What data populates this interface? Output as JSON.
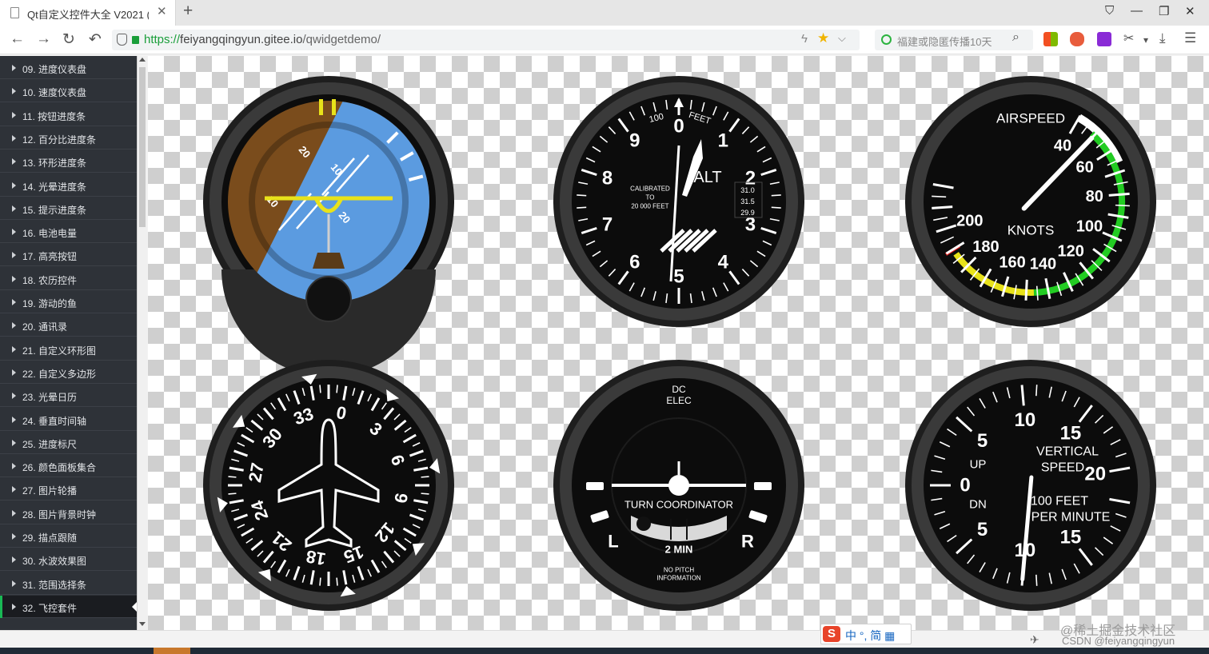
{
  "browser": {
    "tab_title": "Qt自定义控件大全 V2021 (Q",
    "tab_close": "✕",
    "new_tab": "+",
    "url_scheme": "https://",
    "url_host": "feiyangqingyun.gitee.io",
    "url_path": "/qwidgetdemo/",
    "search_placeholder": "福建或隐匿传播10天",
    "icons": {
      "back": "←",
      "forward": "→",
      "reload": "↻",
      "undo": "↶",
      "bolt": "ϟ",
      "star": "★",
      "chevron": "⌵",
      "search": "⌕",
      "shirt": "⛉",
      "minimize": "—",
      "restore": "❐",
      "close": "✕",
      "cut": "✂",
      "download": "⤓",
      "menu": "☰",
      "drop": "▾"
    }
  },
  "sidebar": {
    "items": [
      {
        "label": "09. 进度仪表盘"
      },
      {
        "label": "10. 速度仪表盘"
      },
      {
        "label": "11. 按钮进度条"
      },
      {
        "label": "12. 百分比进度条"
      },
      {
        "label": "13. 环形进度条"
      },
      {
        "label": "14. 光晕进度条"
      },
      {
        "label": "15. 提示进度条"
      },
      {
        "label": "16. 电池电量"
      },
      {
        "label": "17. 高亮按钮"
      },
      {
        "label": "18. 农历控件"
      },
      {
        "label": "19. 游动的鱼"
      },
      {
        "label": "20. 通讯录"
      },
      {
        "label": "21. 自定义环形图"
      },
      {
        "label": "22. 自定义多边形"
      },
      {
        "label": "23. 光晕日历"
      },
      {
        "label": "24. 垂直时间轴"
      },
      {
        "label": "25. 进度标尺"
      },
      {
        "label": "26. 颜色面板集合"
      },
      {
        "label": "27. 图片轮播"
      },
      {
        "label": "28. 图片背景时钟"
      },
      {
        "label": "29. 描点跟随"
      },
      {
        "label": "30. 水波效果图"
      },
      {
        "label": "31. 范围选择条"
      },
      {
        "label": "32. 飞控套件"
      }
    ],
    "active_index": 23
  },
  "gauges": {
    "attitude": {
      "pitch_labels": [
        "20",
        "10",
        "10",
        "20"
      ],
      "roll_labels": [
        "10",
        "10"
      ],
      "colors": {
        "sky": "#5b9be0",
        "ground": "#7a4c1c",
        "indicator": "#e8e21a"
      }
    },
    "altimeter": {
      "digits": [
        "0",
        "1",
        "2",
        "3",
        "4",
        "5",
        "6",
        "7",
        "8",
        "9"
      ],
      "label_feet": "FEET",
      "label_100": "100",
      "label_alt": "ALT",
      "calibrated": [
        "CALIBRATED",
        "TO",
        "20 000 FEET"
      ],
      "baro": [
        "31.0",
        "31.5",
        "29.9"
      ],
      "hand_angle_deg": 200
    },
    "airspeed": {
      "title": "AIRSPEED",
      "units": "KNOTS",
      "labels": [
        "40",
        "60",
        "80",
        "100",
        "120",
        "140",
        "160",
        "180",
        "200"
      ],
      "needle_knots": 50,
      "colors": {
        "white_arc": "#ffffff",
        "green_arc": "#22cc22",
        "yellow_arc": "#e8e21a",
        "red_line": "#e02020"
      }
    },
    "heading": {
      "labels": [
        "0",
        "3",
        "6",
        "9",
        "12",
        "15",
        "18",
        "21",
        "24",
        "27",
        "30",
        "33"
      ],
      "heading_deg": 10
    },
    "turn": {
      "top": [
        "DC",
        "ELEC"
      ],
      "title": "TURN COORDINATOR",
      "left": "L",
      "right": "R",
      "min": "2 MIN",
      "note": [
        "NO PITCH",
        "INFORMATION"
      ]
    },
    "vsi": {
      "labels": [
        "0",
        "5",
        "10",
        "15",
        "20",
        "15",
        "10",
        "5"
      ],
      "up": "UP",
      "dn": "DN",
      "title": [
        "VERTICAL",
        "SPEED"
      ],
      "units": [
        "100 FEET",
        "PER MINUTE"
      ],
      "needle_value": -10
    }
  },
  "bottom": {
    "ime_logo": "S",
    "ime_text": "中 °, 简 ▦",
    "watermark": "@稀土掘金技术社区",
    "csdn": "CSDN @feiyangqingyun",
    "plane": "✈"
  }
}
